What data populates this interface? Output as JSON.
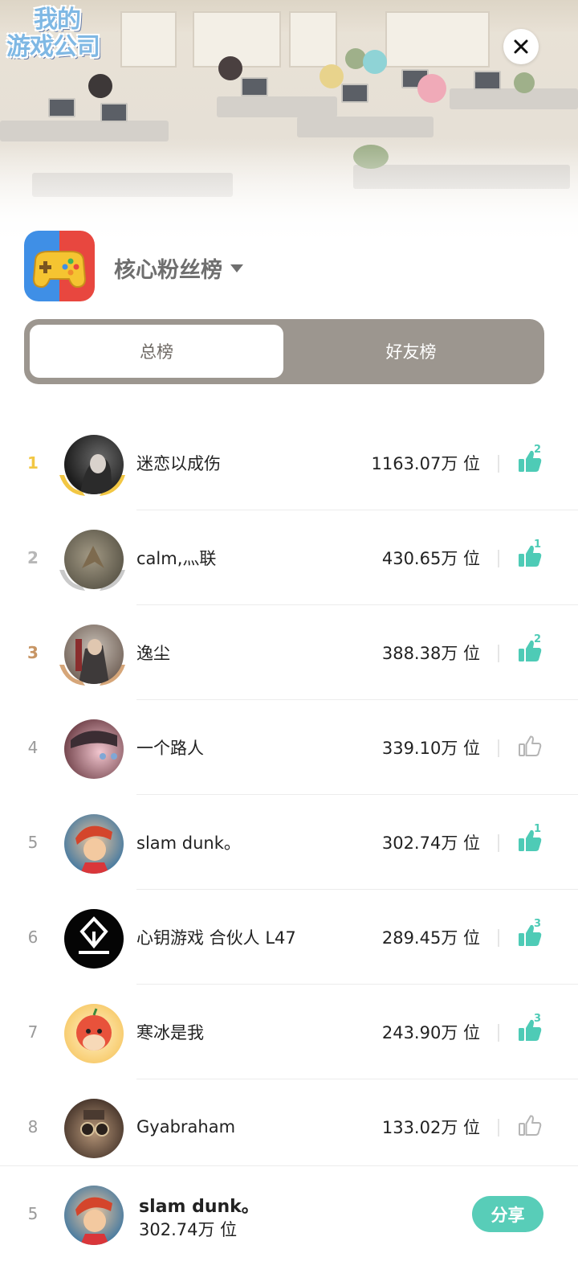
{
  "header": {
    "game_logo_lines": [
      "我的",
      "游戏公司"
    ],
    "close_icon": "close-icon"
  },
  "board": {
    "title": "核心粉丝榜",
    "dropdown_icon": "caret-down-icon"
  },
  "tabs": [
    {
      "label": "总榜",
      "active": true
    },
    {
      "label": "好友榜",
      "active": false
    }
  ],
  "ranking": [
    {
      "rank": "1",
      "name": "迷恋以成伤",
      "score": "1163.07万 位",
      "likes": "2",
      "liked": true
    },
    {
      "rank": "2",
      "name": "calm,灬联",
      "score": "430.65万 位",
      "likes": "1",
      "liked": true
    },
    {
      "rank": "3",
      "name": "逸尘",
      "score": "388.38万 位",
      "likes": "2",
      "liked": true
    },
    {
      "rank": "4",
      "name": "一个路人",
      "score": "339.10万 位",
      "likes": "",
      "liked": false
    },
    {
      "rank": "5",
      "name": "slam dunk。",
      "score": "302.74万 位",
      "likes": "1",
      "liked": true
    },
    {
      "rank": "6",
      "name": "心钥游戏 合伙人 L47",
      "score": "289.45万 位",
      "likes": "3",
      "liked": true
    },
    {
      "rank": "7",
      "name": "寒冰是我",
      "score": "243.90万 位",
      "likes": "3",
      "liked": true
    },
    {
      "rank": "8",
      "name": "Gyabraham",
      "score": "133.02万 位",
      "likes": "",
      "liked": false
    }
  ],
  "me": {
    "rank": "5",
    "name": "slam dunk。",
    "score": "302.74万 位",
    "share_label": "分享"
  },
  "colors": {
    "accent": "#58cdb8",
    "tab_bg": "#9c968f",
    "gold": "#f2c744",
    "silver": "#b7b7b7",
    "bronze": "#c79564"
  }
}
